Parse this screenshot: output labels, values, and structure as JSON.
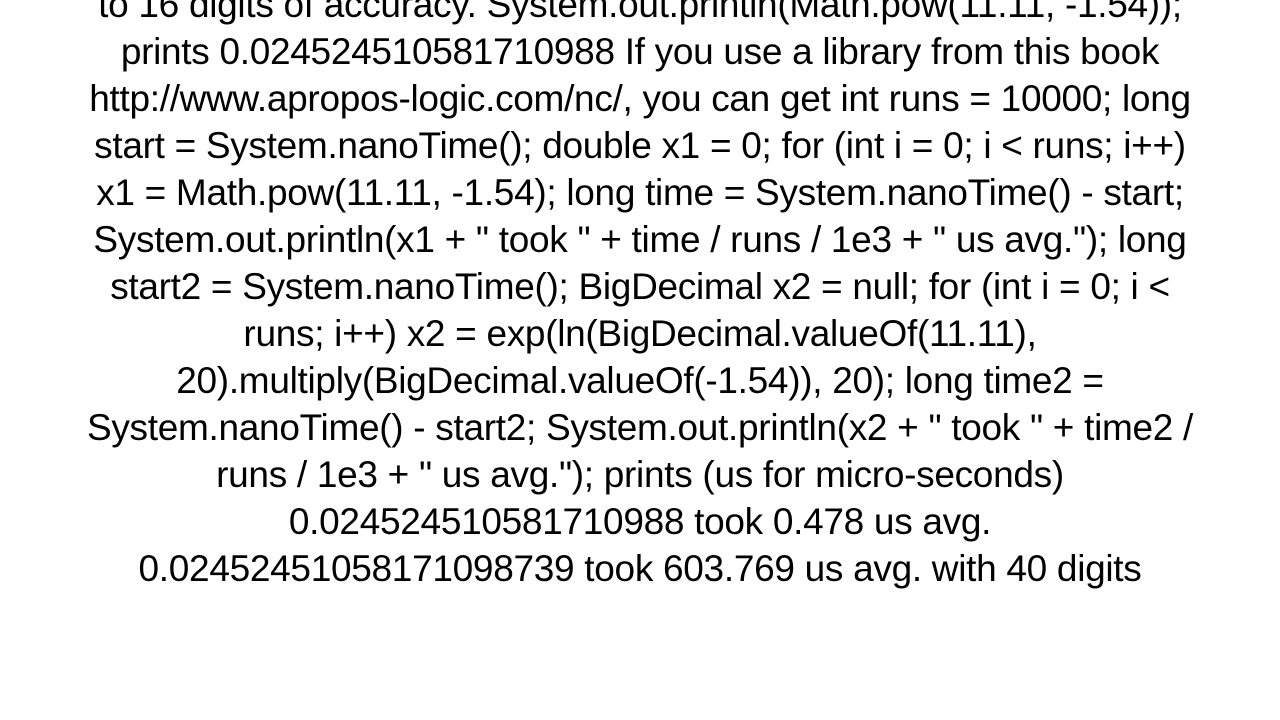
{
  "document": {
    "text": "to 16 digits of accuracy. System.out.println(Math.pow(11.11, -1.54));  prints 0.024524510581710988  If you use a library from this book http://www.apropos-logic.com/nc/, you can get int runs = 10000;  long start = System.nanoTime(); double x1 = 0; for (int i = 0; i < runs; i++)     x1 = Math.pow(11.11, -1.54); long time = System.nanoTime() - start; System.out.println(x1 + \" took \" + time / runs / 1e3 + \" us avg.\");  long start2 = System.nanoTime(); BigDecimal x2 = null; for (int i = 0; i < runs; i++)     x2 = exp(ln(BigDecimal.valueOf(11.11), 20).multiply(BigDecimal.valueOf(-1.54)), 20); long time2 = System.nanoTime() - start2; System.out.println(x2 + \" took \" + time2 / runs / 1e3 + \" us avg.\");  prints (us for micro-seconds) 0.024524510581710988 took 0.478 us avg. 0.02452451058171098739 took 603.769 us avg.  with 40 digits"
  }
}
